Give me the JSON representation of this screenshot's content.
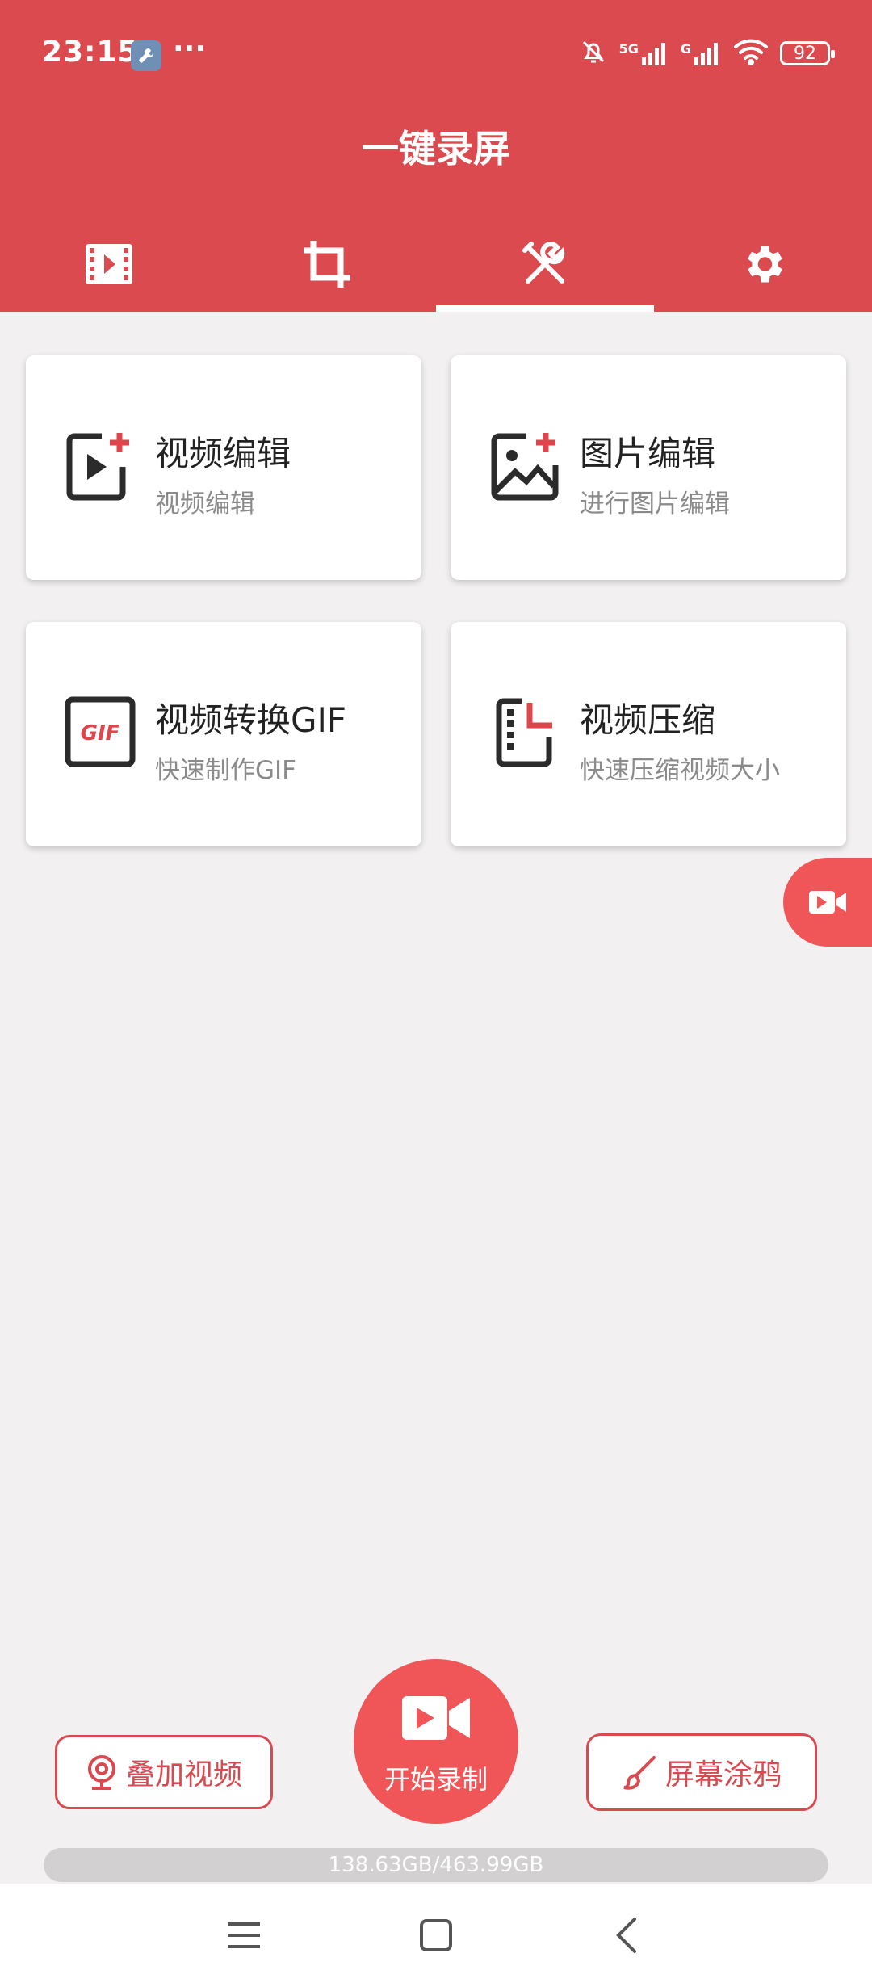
{
  "status_bar": {
    "time": "23:15",
    "dots": "···",
    "net1": "5G",
    "net2": "G",
    "battery": "92"
  },
  "app": {
    "title": "一键录屏"
  },
  "tabs": [
    {
      "icon": "film-icon"
    },
    {
      "icon": "crop-icon"
    },
    {
      "icon": "tools-icon",
      "active": true
    },
    {
      "icon": "gear-icon"
    }
  ],
  "tools": [
    {
      "title": "视频编辑",
      "subtitle": "视频编辑",
      "icon": "video-add-icon"
    },
    {
      "title": "图片编辑",
      "subtitle": "进行图片编辑",
      "icon": "image-add-icon"
    },
    {
      "title": "视频转换GIF",
      "subtitle": "快速制作GIF",
      "icon": "gif-icon",
      "icon_text": "GIF"
    },
    {
      "title": "视频压缩",
      "subtitle": "快速压缩视频大小",
      "icon": "compress-icon"
    }
  ],
  "bottom": {
    "overlay_label": "叠加视频",
    "record_label": "开始录制",
    "doodle_label": "屏幕涂鸦",
    "storage": "138.63GB/463.99GB"
  },
  "colors": {
    "primary": "#da4a4f",
    "accent": "#f05557"
  }
}
